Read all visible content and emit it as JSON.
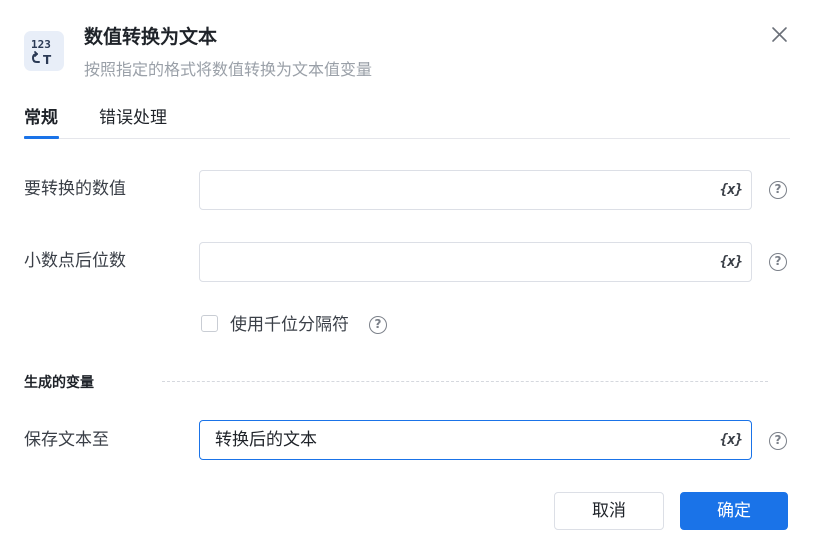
{
  "dialog": {
    "icon": "number-to-text-icon",
    "title": "数值转换为文本",
    "subtitle": "按照指定的格式将数值转换为文本值变量"
  },
  "tabs": [
    {
      "label": "常规",
      "active": true
    },
    {
      "label": "错误处理",
      "active": false
    }
  ],
  "fields": {
    "number_to_convert": {
      "label": "要转换的数值",
      "value": "",
      "var_icon": "{x}"
    },
    "decimal_places": {
      "label": "小数点后位数",
      "value": "",
      "var_icon": "{x}"
    },
    "use_thousands_separator": {
      "label": "使用千位分隔符",
      "checked": false
    }
  },
  "output_section": {
    "title": "生成的变量",
    "save_to": {
      "label": "保存文本至",
      "value": "转换后的文本",
      "var_icon": "{x}"
    }
  },
  "buttons": {
    "cancel": "取消",
    "ok": "确定"
  },
  "colors": {
    "accent": "#1a73e8",
    "icon_bg": "#e8eef8"
  }
}
